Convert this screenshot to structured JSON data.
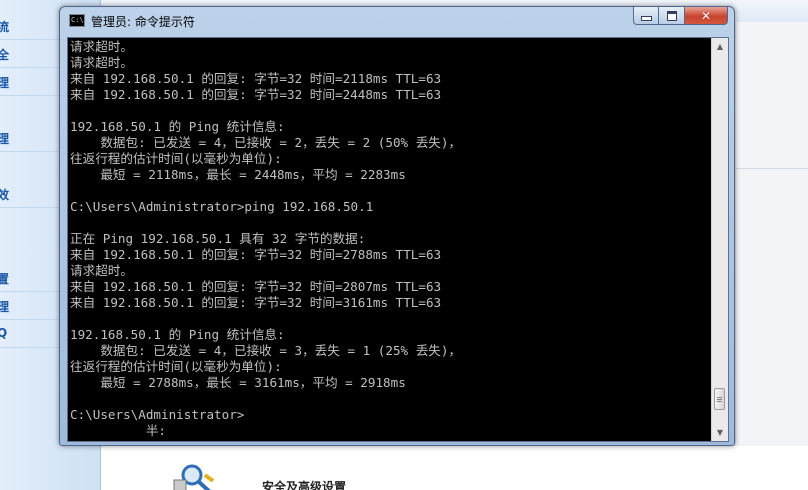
{
  "background_app": {
    "sidebar_items": [
      "流",
      "全",
      "理",
      "理",
      "效",
      "置",
      "理",
      "Q"
    ],
    "bottom_section_title": "安全及高级设置",
    "bottom_icon": "magnifier-tools-icon"
  },
  "console": {
    "title": "管理员: 命令提示符",
    "icon": "cmd-icon",
    "icon_text": "C:\\",
    "buttons": {
      "minimize": "minimize-icon",
      "maximize": "maximize-icon",
      "close": "close-icon",
      "close_glyph": "✕"
    },
    "lines": [
      "请求超时。",
      "请求超时。",
      "来自 192.168.50.1 的回复: 字节=32 时间=2118ms TTL=63",
      "来自 192.168.50.1 的回复: 字节=32 时间=2448ms TTL=63",
      "",
      "192.168.50.1 的 Ping 统计信息:",
      "    数据包: 已发送 = 4，已接收 = 2，丢失 = 2 (50% 丢失)，",
      "往返行程的估计时间(以毫秒为单位):",
      "    最短 = 2118ms，最长 = 2448ms，平均 = 2283ms",
      "",
      "C:\\Users\\Administrator>ping 192.168.50.1",
      "",
      "正在 Ping 192.168.50.1 具有 32 字节的数据:",
      "来自 192.168.50.1 的回复: 字节=32 时间=2788ms TTL=63",
      "请求超时。",
      "来自 192.168.50.1 的回复: 字节=32 时间=2807ms TTL=63",
      "来自 192.168.50.1 的回复: 字节=32 时间=3161ms TTL=63",
      "",
      "192.168.50.1 的 Ping 统计信息:",
      "    数据包: 已发送 = 4，已接收 = 3，丢失 = 1 (25% 丢失)，",
      "往返行程的估计时间(以毫秒为单位):",
      "    最短 = 2788ms，最长 = 3161ms，平均 = 2918ms",
      "",
      "C:\\Users\\Administrator>",
      "          半:"
    ],
    "scrollbar": {
      "up_arrow": "▲",
      "down_arrow": "▼",
      "thumb_position": 0.96
    }
  },
  "colors": {
    "console_background": "#000000",
    "console_text": "#c0c0c0",
    "titlebar": "#bcd2ea",
    "close_button": "#c7432c"
  }
}
